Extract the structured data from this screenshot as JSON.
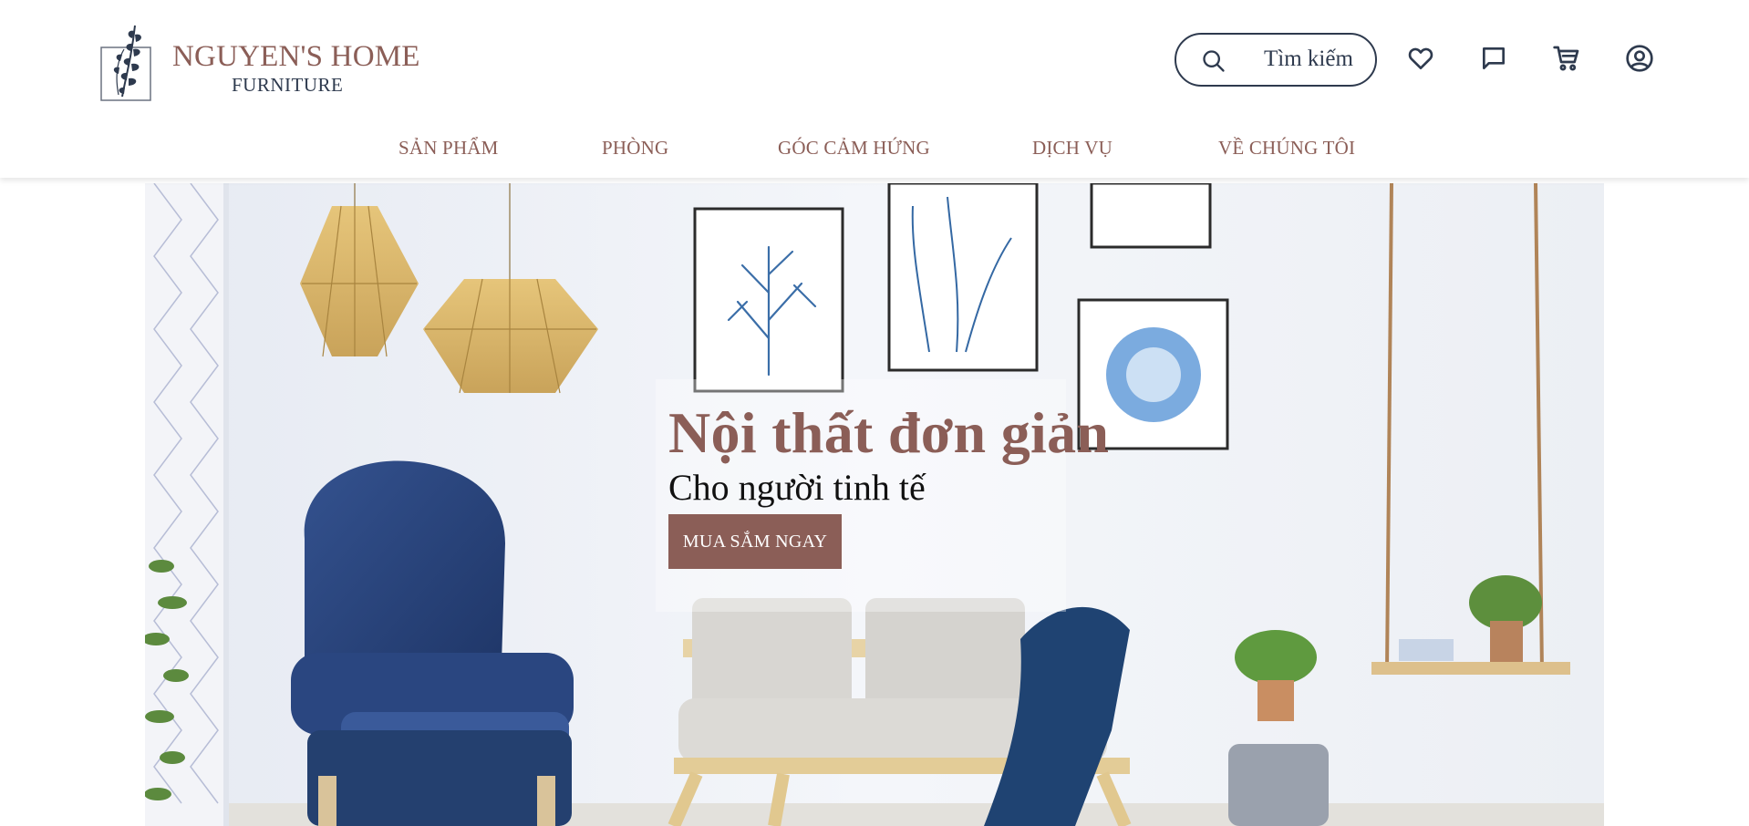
{
  "brand": {
    "name": "NGUYEN'S HOME",
    "subtitle": "FURNITURE",
    "logo_icon": "leaf-branch-icon",
    "color_primary": "#8b5e57",
    "color_dark": "#2e3a4e"
  },
  "header": {
    "search": {
      "label": "Tìm kiếm",
      "icon": "search-icon"
    },
    "actions": [
      {
        "name": "wishlist",
        "icon": "heart-icon"
      },
      {
        "name": "messages",
        "icon": "chat-icon"
      },
      {
        "name": "cart",
        "icon": "cart-icon"
      },
      {
        "name": "account",
        "icon": "user-icon"
      }
    ]
  },
  "nav": {
    "items": [
      {
        "label": "SẢN PHẨM"
      },
      {
        "label": "PHÒNG"
      },
      {
        "label": "GÓC CẢM HỨNG"
      },
      {
        "label": "DỊCH VỤ"
      },
      {
        "label": "VỀ CHÚNG TÔI"
      }
    ]
  },
  "hero": {
    "title": "Nội thất đơn giản",
    "subtitle": "Cho người tinh tế",
    "cta": "MUA SẮM NGAY"
  }
}
